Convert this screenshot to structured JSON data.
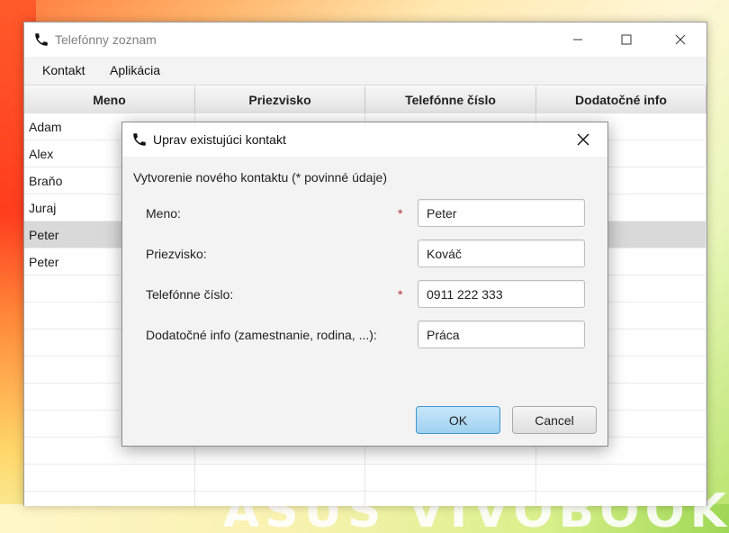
{
  "wallpaper": {
    "brand_text": "ASUS VIVOBOOK"
  },
  "window": {
    "title": "Telefónny zoznam",
    "menu": [
      "Kontakt",
      "Aplikácia"
    ]
  },
  "table": {
    "columns": [
      "Meno",
      "Priezvisko",
      "Telefónne číslo",
      "Dodatočné info"
    ],
    "rows": [
      [
        "Adam",
        "",
        "",
        ""
      ],
      [
        "Alex",
        "",
        "",
        ""
      ],
      [
        "Braňo",
        "",
        "",
        ""
      ],
      [
        "Juraj",
        "",
        "",
        ""
      ],
      [
        "Peter",
        "",
        "",
        ""
      ],
      [
        "Peter",
        "",
        "",
        ""
      ],
      [
        "",
        "",
        "",
        ""
      ],
      [
        "",
        "",
        "",
        ""
      ],
      [
        "",
        "",
        "",
        ""
      ],
      [
        "",
        "",
        "",
        ""
      ],
      [
        "",
        "",
        "",
        ""
      ],
      [
        "",
        "",
        "",
        ""
      ],
      [
        "",
        "",
        "",
        ""
      ],
      [
        "",
        "",
        "",
        ""
      ],
      [
        "",
        "",
        "",
        ""
      ]
    ],
    "selected_row": 4
  },
  "dialog": {
    "title": "Uprav existujúci kontakt",
    "heading": "Vytvorenie nového kontaktu (* povinné údaje)",
    "required_mark": "*",
    "fields": [
      {
        "label": "Meno:",
        "value": "Peter",
        "required": true
      },
      {
        "label": "Priezvisko:",
        "value": "Kováč",
        "required": false
      },
      {
        "label": "Telefónne číslo:",
        "value": "0911 222 333",
        "required": true
      },
      {
        "label": "Dodatočné info (zamestnanie, rodina, ...):",
        "value": "Práca",
        "required": false
      }
    ],
    "ok_label": "OK",
    "cancel_label": "Cancel"
  },
  "colors": {
    "accent": "#3f95cf",
    "selected_row": "#d9d9d9",
    "required": "#b03030"
  },
  "icons": [
    "phone-icon",
    "minimize-icon",
    "maximize-icon",
    "close-icon"
  ]
}
